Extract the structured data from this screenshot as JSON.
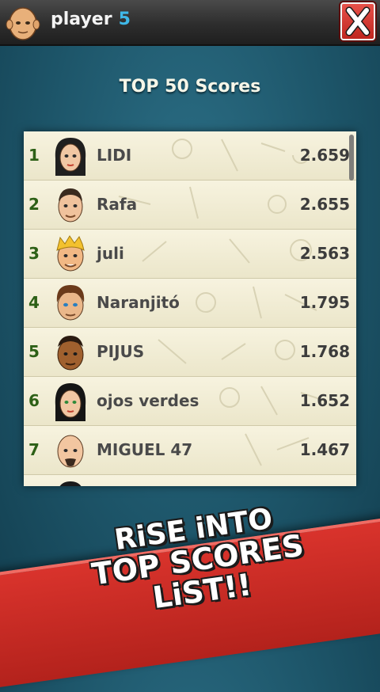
{
  "header": {
    "player_label": "player",
    "player_number": "5",
    "close_label": "X"
  },
  "title": "TOP 50 Scores",
  "scores": [
    {
      "rank": "1",
      "name": "LIDI",
      "score": "2.659",
      "avatar": "woman-dark-hair-icon"
    },
    {
      "rank": "2",
      "name": "Rafa",
      "score": "2.655",
      "avatar": "man-short-hair-icon"
    },
    {
      "rank": "3",
      "name": "juli",
      "score": "2.563",
      "avatar": "man-blond-hair-icon"
    },
    {
      "rank": "4",
      "name": "Naranjitó",
      "score": "1.795",
      "avatar": "man-brown-hair-icon"
    },
    {
      "rank": "5",
      "name": "PIJUS",
      "score": "1.768",
      "avatar": "man-dark-skin-icon"
    },
    {
      "rank": "6",
      "name": "ojos verdes",
      "score": "1.652",
      "avatar": "woman-black-hair-icon"
    },
    {
      "rank": "7",
      "name": "MIGUEL 47",
      "score": "1.467",
      "avatar": "man-bald-goatee-icon"
    }
  ],
  "banner": {
    "line1": "RiSE iNTO",
    "line2": "TOP SCORES LiST!!"
  },
  "colors": {
    "background": "#1d5569",
    "list_background": "#f1ecd5",
    "rank_color": "#2d6016",
    "banner_red": "#c8281f",
    "player_number_color": "#3fb8e8"
  }
}
